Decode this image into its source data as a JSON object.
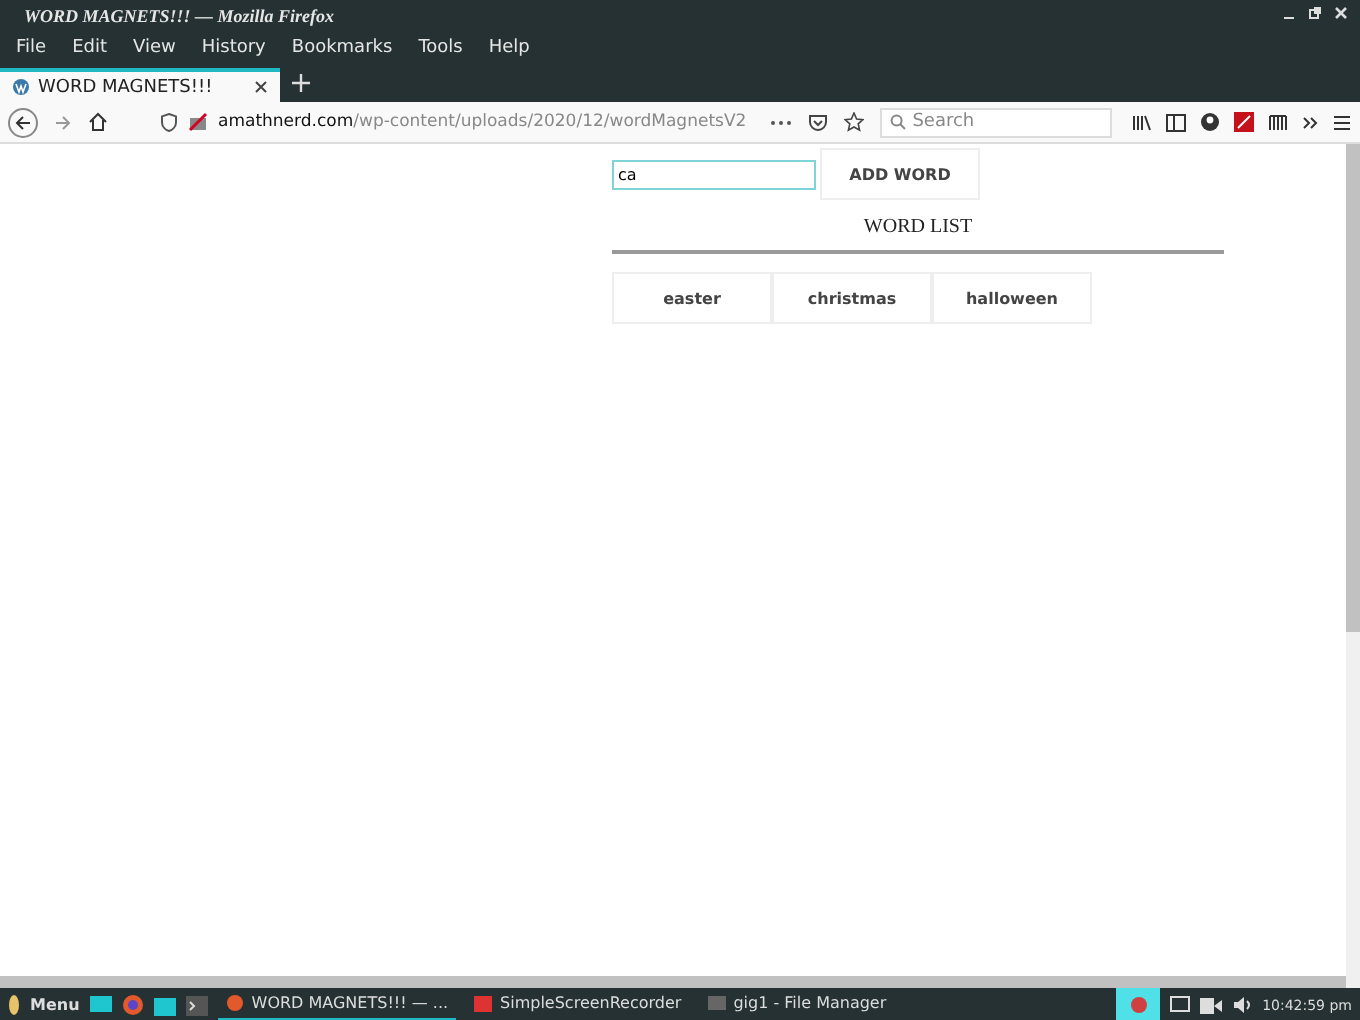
{
  "window": {
    "title": "WORD MAGNETS!!! — Mozilla Firefox"
  },
  "menu": [
    "File",
    "Edit",
    "View",
    "History",
    "Bookmarks",
    "Tools",
    "Help"
  ],
  "tabs": [
    {
      "label": "WORD MAGNETS!!!",
      "selected": true
    }
  ],
  "address": {
    "domain": "amathnerd.com",
    "path": "/wp-content/uploads/2020/12/wordMagnetsV2"
  },
  "search": {
    "placeholder": "Search"
  },
  "page": {
    "input": {
      "value": "ca"
    },
    "add_button": "ADD WORD",
    "list_title": "WORD LIST",
    "words": [
      "easter",
      "christmas",
      "halloween"
    ]
  },
  "taskbar": {
    "menu": "Menu",
    "windows": [
      {
        "label": "WORD MAGNETS!!! — ...",
        "selected": true
      },
      {
        "label": "SimpleScreenRecorder",
        "selected": false
      },
      {
        "label": "gig1 - File Manager",
        "selected": false
      }
    ],
    "clock": "10:42:59 pm"
  }
}
